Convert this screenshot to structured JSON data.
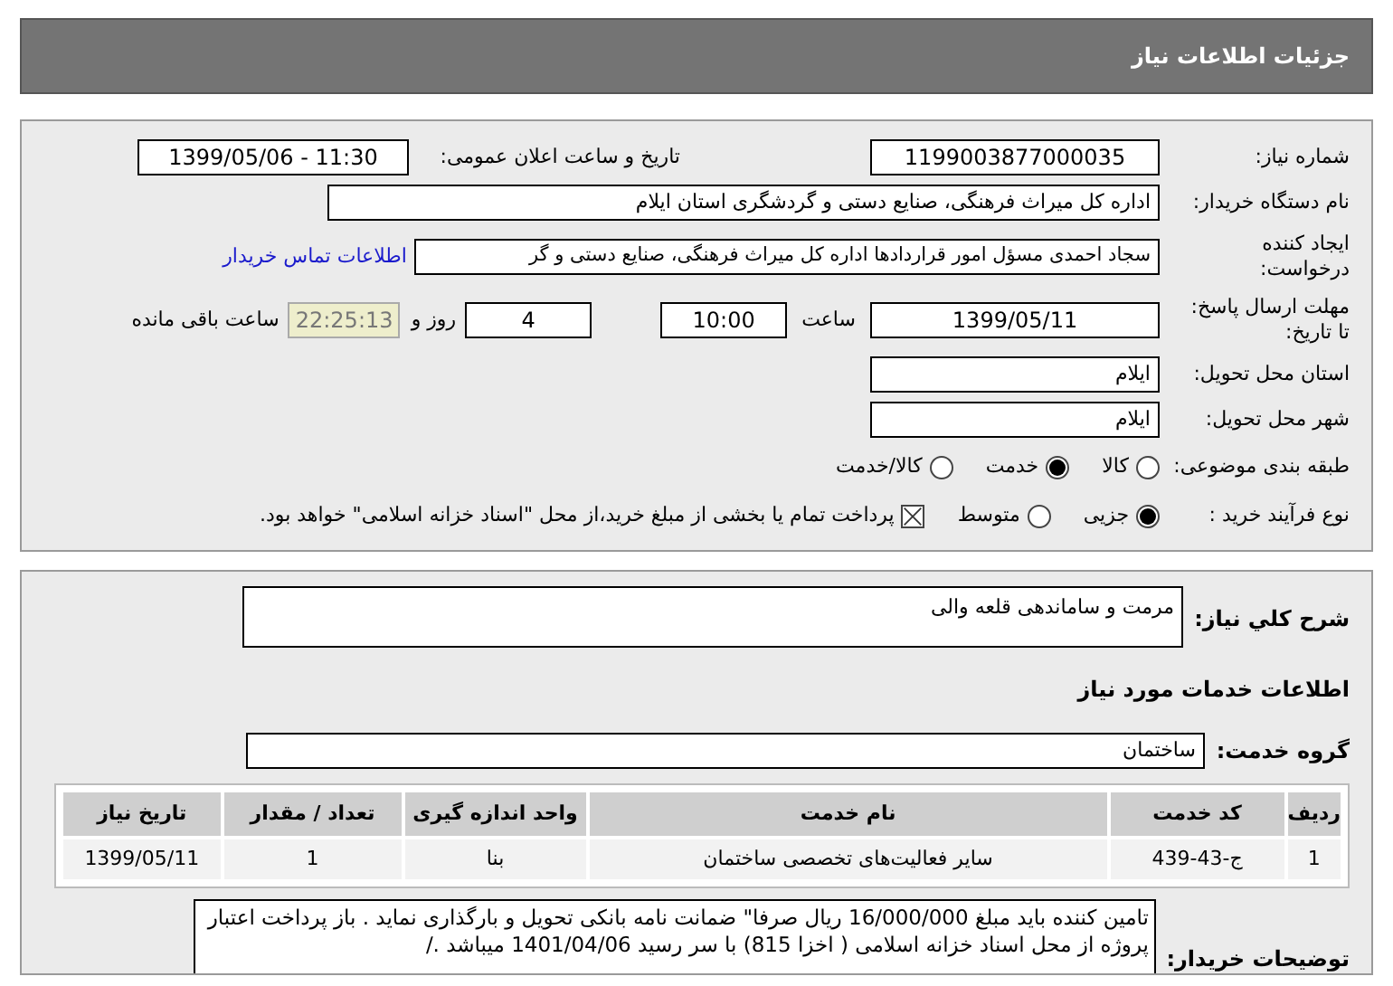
{
  "header": {
    "title": "جزئیات اطلاعات نیاز"
  },
  "need_number": {
    "label": "شماره نیاز:",
    "value": "1199003877000035"
  },
  "announce": {
    "label": "تاریخ و ساعت اعلان عمومی:",
    "value": "1399/05/06 - 11:30"
  },
  "buyer": {
    "label": "نام دستگاه خریدار:",
    "value": "اداره کل میراث فرهنگی، صنایع دستی و گردشگری استان ایلام"
  },
  "creator": {
    "label_lines": [
      "ایجاد کننده",
      "درخواست:"
    ],
    "value": "سجاد احمدی مسؤل امور قراردادها اداره کل میراث فرهنگی، صنایع دستی و گر",
    "link": "اطلاعات تماس خریدار"
  },
  "deadline": {
    "label_lines": [
      "مهلت ارسال پاسخ:",
      "تا تاریخ:"
    ],
    "date": "1399/05/11",
    "time_label": "ساعت",
    "time": "10:00",
    "days": "4",
    "days_label": "روز و",
    "remaining": "22:25:13",
    "remaining_label": "ساعت باقی مانده"
  },
  "province": {
    "label": "استان محل تحویل:",
    "value": "ایلام"
  },
  "city": {
    "label": "شهر محل تحویل:",
    "value": "ایلام"
  },
  "category": {
    "label": "طبقه بندی موضوعی:",
    "options": [
      {
        "label": "کالا",
        "selected": false
      },
      {
        "label": "خدمت",
        "selected": true
      },
      {
        "label": "کالا/خدمت",
        "selected": false
      }
    ]
  },
  "purchase_type": {
    "label": "نوع فرآیند خرید :",
    "options": [
      {
        "label": "جزیی",
        "selected": true
      },
      {
        "label": "متوسط",
        "selected": false
      }
    ],
    "payment": {
      "checked": true,
      "text": "پرداخت تمام یا بخشی از مبلغ خرید،از محل \"اسناد خزانه اسلامی\" خواهد بود."
    }
  },
  "description": {
    "label": "شرح کلي نياز:",
    "value": "مرمت و ساماندهی قلعه والی"
  },
  "services_heading": "اطلاعات خدمات مورد نیاز",
  "service_group": {
    "label": "گروه خدمت:",
    "value": "ساختمان"
  },
  "table": {
    "columns": [
      "ردیف",
      "کد خدمت",
      "نام خدمت",
      "واحد اندازه گیری",
      "تعداد / مقدار",
      "تاریخ نیاز"
    ],
    "rows": [
      [
        "1",
        "ج-43-439",
        "سایر فعالیت‌های تخصصی ساختمان",
        "بنا",
        "1",
        "1399/05/11"
      ]
    ]
  },
  "notes": {
    "label": "توضیحات خریدار:",
    "value": "تامین کننده باید مبلغ 16/000/000 ریال صرفا\" ضمانت نامه بانکی تحویل و بارگذاری نماید . باز پرداخت اعتبار پروژه از محل اسناد خزانه اسلامی ( اخزا 815) با سر رسید 1401/04/06 میباشد ./"
  }
}
